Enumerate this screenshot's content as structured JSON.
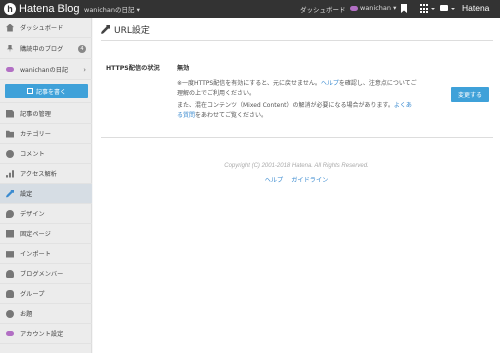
{
  "topbar": {
    "brand": "Hatena Blog",
    "blog_switch": "wanichanの日記 ▾",
    "dashboard": "ダッシュボード",
    "user": "wanichan ▾",
    "hatena": "Hatena"
  },
  "sidebar": {
    "items": [
      {
        "label": "ダッシュボード",
        "icon": "house-icon"
      },
      {
        "label": "購読中のブログ",
        "icon": "pin-icon",
        "badge": "4"
      },
      {
        "label": "wanichanの日記",
        "icon": "avatar-icon"
      },
      {
        "label": "記事の管理",
        "icon": "document-icon"
      },
      {
        "label": "カテゴリー",
        "icon": "folder-icon"
      },
      {
        "label": "コメント",
        "icon": "comment-icon"
      },
      {
        "label": "アクセス解析",
        "icon": "chart-icon"
      },
      {
        "label": "設定",
        "icon": "wrench-icon"
      },
      {
        "label": "デザイン",
        "icon": "palette-icon"
      },
      {
        "label": "固定ページ",
        "icon": "page-icon"
      },
      {
        "label": "インポート",
        "icon": "import-icon"
      },
      {
        "label": "ブログメンバー",
        "icon": "members-icon"
      },
      {
        "label": "グループ",
        "icon": "group-icon"
      },
      {
        "label": "お題",
        "icon": "theme-icon"
      },
      {
        "label": "アカウント設定",
        "icon": "account-icon"
      }
    ],
    "write_button": "記事を書く",
    "active_color": "#3b8bd0"
  },
  "main": {
    "title": "URL設定",
    "setting_label": "HTTPS配信の状況",
    "setting_value": "無効",
    "note1_a": "※一度HTTPS配信を有効にすると、元に戻せません。",
    "note1_link": "ヘルプ",
    "note1_b": "を確認し、注意点についてご理解の上でご利用ください。",
    "note2_a": "また、混在コンテンツ（Mixed Content）の解消が必要になる場合があります。",
    "note2_link": "よくある質問",
    "note2_b": "をあわせてご覧ください。",
    "change_button": "変更する"
  },
  "footer": {
    "copyright": "Copyright (C) 2001-2018 Hatena. All Rights Reserved.",
    "help": "ヘルプ",
    "guideline": "ガイドライン"
  },
  "colors": {
    "topbar": "#333333",
    "button": "#3fa1d9",
    "link": "#3b8bd0"
  }
}
